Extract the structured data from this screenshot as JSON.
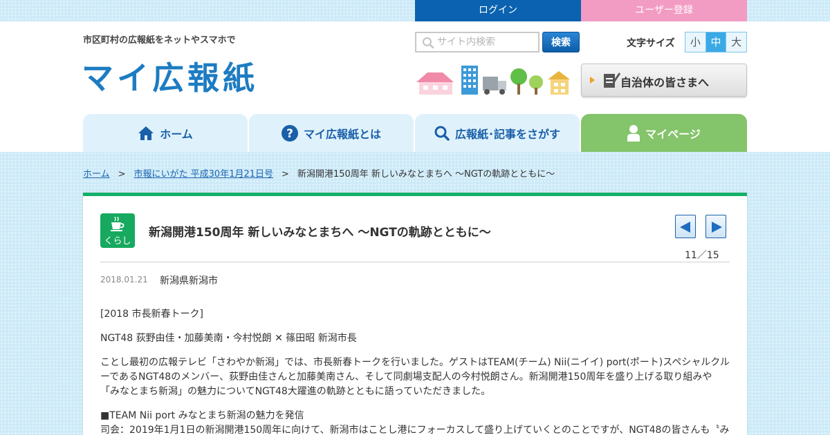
{
  "top": {
    "login_label": "ログイン",
    "register_label": "ユーザー登録"
  },
  "header": {
    "tagline": "市区町村の広報紙をネットやスマホで",
    "logo": "マイ広報紙",
    "search_placeholder": "サイト内検索",
    "search_button": "検索",
    "font_size_label": "文字サイズ",
    "font_sizes": [
      "小",
      "中",
      "大"
    ],
    "font_size_selected": "中",
    "gov_button": "自治体の皆さまへ"
  },
  "nav": {
    "home": "ホーム",
    "about": "マイ広報紙とは",
    "search": "広報紙･記事をさがす",
    "mypage": "マイページ"
  },
  "breadcrumb": {
    "home": "ホーム",
    "issue": "市報にいがた 平成30年1月21日号",
    "current": "新潟開港150周年 新しいみなとまちへ 〜NGTの軌跡とともに〜",
    "separator": ">"
  },
  "article": {
    "category": "くらし",
    "title": "新潟開港150周年 新しいみなとまちへ 〜NGTの軌跡とともに〜",
    "pager": "11／15",
    "date": "2018.01.21",
    "city": "新潟県新潟市",
    "paragraphs": [
      "[2018 市長新春トーク]",
      "NGT48 荻野由佳・加藤美南・今村悦朗 ✕ 篠田昭 新潟市長",
      "ことし最初の広報テレビ「さわやか新潟」では、市長新春トークを行いました。ゲストはTEAM(チーム) Nii(ニイイ) port(ポート)スペシャルクルーであるNGT48のメンバー、荻野由佳さんと加藤美南さん、そして同劇場支配人の今村悦朗さん。新潟開港150周年を盛り上げる取り組みや「みなとまち新潟」の魅力についてNGT48大躍進の軌跡とともに語っていただきました。",
      "■TEAM Nii port みなとまち新潟の魅力を発信",
      "司会：2019年1月1日の新潟開港150周年に向けて、新潟市はことし港にフォーカスして盛り上げていくとのことですが、NGT48の皆さんも〝み"
    ]
  },
  "colors": {
    "login_bg": "#0b62b0",
    "register_bg": "#f39cc3",
    "brand_blue": "#1d7cc2",
    "mypage_tab": "#84c46a",
    "card_border": "#14b06a"
  }
}
